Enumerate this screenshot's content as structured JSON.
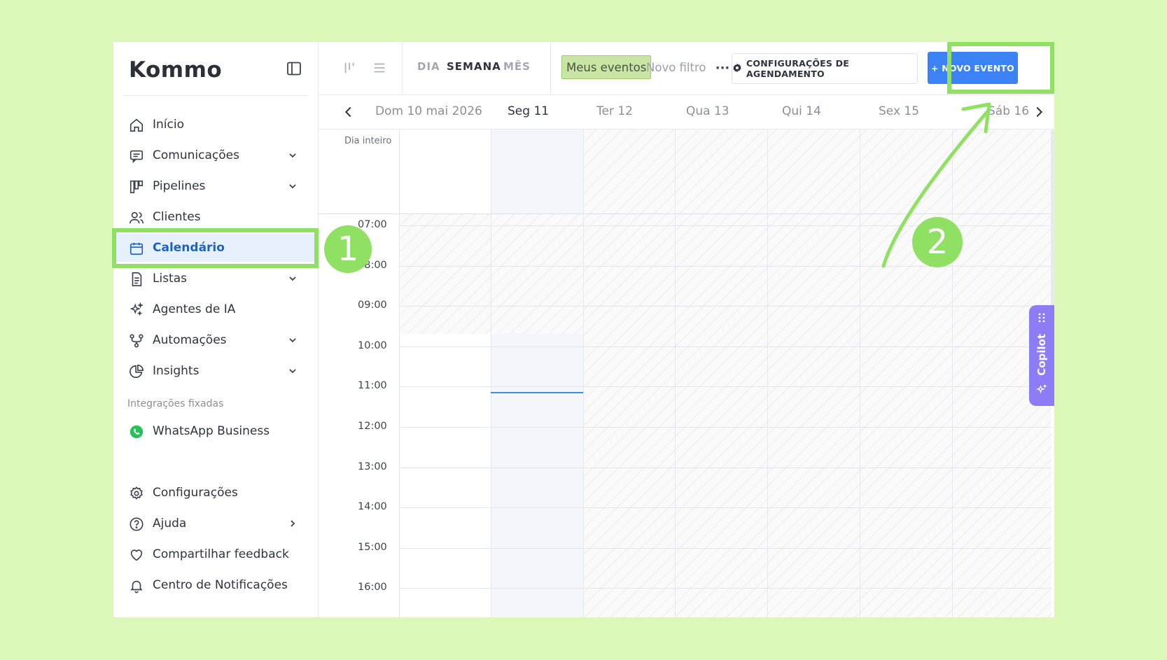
{
  "brand": {
    "logo_text": "Kommo"
  },
  "sidebar": {
    "items": [
      {
        "label": "Início",
        "icon": "home-icon",
        "has_chevron": false
      },
      {
        "label": "Comunicações",
        "icon": "chat-icon",
        "has_chevron": true
      },
      {
        "label": "Pipelines",
        "icon": "pipeline-icon",
        "has_chevron": true
      },
      {
        "label": "Clientes",
        "icon": "users-icon",
        "has_chevron": false
      },
      {
        "label": "Calendário",
        "icon": "calendar-icon",
        "has_chevron": false,
        "active": true
      },
      {
        "label": "Listas",
        "icon": "list-doc-icon",
        "has_chevron": true
      },
      {
        "label": "Agentes de IA",
        "icon": "sparkles-icon",
        "has_chevron": false
      },
      {
        "label": "Automações",
        "icon": "automation-icon",
        "has_chevron": true
      },
      {
        "label": "Insights",
        "icon": "pie-chart-icon",
        "has_chevron": true
      }
    ],
    "pinned_section_label": "Integrações fixadas",
    "pinned": [
      {
        "label": "WhatsApp Business",
        "icon": "whatsapp-icon"
      }
    ],
    "bottom_items": [
      {
        "label": "Configurações",
        "icon": "gear-icon"
      },
      {
        "label": "Ajuda",
        "icon": "help-icon",
        "has_chevron_right": true
      },
      {
        "label": "Compartilhar feedback",
        "icon": "heart-icon"
      },
      {
        "label": "Centro de Notificações",
        "icon": "bell-icon"
      }
    ]
  },
  "toolbar": {
    "view_tabs": [
      "DIA",
      "SEMANA",
      "MÊS"
    ],
    "active_view": "SEMANA",
    "filters": {
      "active": "Meus eventos",
      "inactive": "Novo filtro"
    },
    "more_label": "···",
    "schedule_settings_label": "CONFIGURAÇÕES DE AGENDAMENTO",
    "new_event_label": "+ NOVO EVENTO"
  },
  "week": {
    "days": [
      "Dom 10 mai 2026",
      "Seg 11",
      "Ter 12",
      "Qua 13",
      "Qui 14",
      "Sex 15",
      "Sáb 16"
    ],
    "today": "Seg 11"
  },
  "grid": {
    "all_day_label": "Dia inteiro",
    "hours": [
      "07:00",
      "08:00",
      "09:00",
      "10:00",
      "11:00",
      "12:00",
      "13:00",
      "14:00",
      "15:00",
      "16:00"
    ]
  },
  "copilot": {
    "label": "Copilot"
  },
  "annotations": {
    "step1": "1",
    "step2": "2"
  },
  "colors": {
    "accent": "#3b82f6",
    "active_bg": "#e7f0fd",
    "highlight": "#8fe063",
    "copilot": "#8c7cf5"
  }
}
